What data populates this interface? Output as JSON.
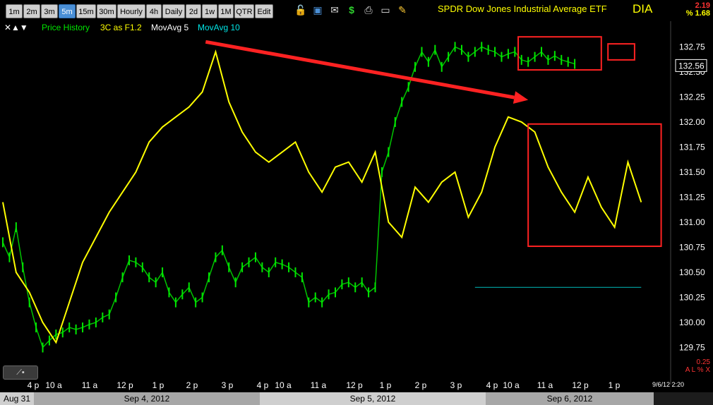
{
  "toolbar": {
    "intervals": [
      "1m",
      "2m",
      "3m",
      "5m",
      "15m",
      "30m",
      "Hourly",
      "4h",
      "Daily",
      "2d",
      "1w",
      "1M",
      "QTR",
      "Edit"
    ],
    "active_interval": "5m"
  },
  "header": {
    "title": "SPDR Dow Jones Industrial Average ETF",
    "symbol": "DIA",
    "change_abs": "2.19",
    "change_pct": "% 1.68"
  },
  "legend": {
    "price_history": "Price History",
    "indicator": "3C as F1.2",
    "ma5": "MovAvg 5",
    "ma10": "MovAvg 10",
    "controls": "✕▲▼"
  },
  "status": {
    "timestamp": "9/6/12 2:20",
    "bottom_value": "0.25",
    "bottom_marks": "A L % X"
  },
  "colors": {
    "price": "#00e600",
    "indicator": "#ffff00",
    "ma10": "#00bbbb",
    "annotation": "#ff2222",
    "axis_text": "#ffffff"
  },
  "chart_data": {
    "type": "line",
    "ylim": [
      129.5,
      132.95
    ],
    "yticks": [
      "132.75",
      "132.50",
      "132.25",
      "132.00",
      "131.75",
      "131.50",
      "131.25",
      "131.00",
      "130.75",
      "130.50",
      "130.25",
      "130.00",
      "129.75"
    ],
    "last_price": "132.56",
    "x_tick_labels": [
      "4 p",
      "10 a",
      "11 a",
      "12 p",
      "1 p",
      "2 p",
      "3 p",
      "4 p",
      "10 a",
      "11 a",
      "12 p",
      "1 p",
      "2 p",
      "3 p",
      "4 p",
      "10 a",
      "11 a",
      "12 p",
      "1 p"
    ],
    "date_labels": [
      "Aug 31",
      "Sep 4, 2012",
      "Sep 5, 2012",
      "Sep 6, 2012"
    ],
    "price_series": {
      "name": "Price History",
      "x": [
        0,
        2,
        4,
        6,
        8,
        10,
        12,
        14,
        16,
        18,
        20,
        22,
        24,
        26,
        28,
        30,
        32,
        34,
        36,
        38,
        40,
        42,
        44,
        46,
        48,
        50,
        52,
        54,
        56,
        58,
        60,
        62,
        64,
        66,
        68,
        70,
        72,
        74,
        76,
        78,
        80,
        82,
        84,
        86,
        88,
        90,
        92,
        94,
        96,
        98,
        100,
        102,
        104,
        106,
        108,
        110,
        112,
        114,
        116,
        118,
        120,
        122,
        124,
        126,
        128,
        130,
        132,
        134,
        136,
        138,
        140,
        142,
        144,
        146,
        148,
        150,
        152,
        154,
        156,
        158,
        160,
        162,
        164,
        166,
        168,
        170,
        172,
        174,
        176,
        178,
        180,
        182,
        184,
        186,
        188,
        190,
        192
      ],
      "y": [
        130.8,
        130.65,
        130.95,
        130.55,
        130.2,
        129.95,
        129.75,
        129.82,
        129.88,
        129.9,
        129.95,
        129.93,
        129.95,
        129.98,
        130.0,
        130.05,
        130.08,
        130.25,
        130.45,
        130.62,
        130.6,
        130.55,
        130.45,
        130.4,
        130.5,
        130.3,
        130.2,
        130.28,
        130.35,
        130.2,
        130.25,
        130.45,
        130.65,
        130.72,
        130.55,
        130.4,
        130.55,
        130.6,
        130.65,
        130.55,
        130.5,
        130.6,
        130.58,
        130.55,
        130.5,
        130.45,
        130.2,
        130.25,
        130.2,
        130.28,
        130.3,
        130.38,
        130.4,
        130.35,
        130.4,
        130.3,
        130.35,
        131.5,
        131.7,
        132.0,
        132.2,
        132.35,
        132.55,
        132.7,
        132.6,
        132.72,
        132.55,
        132.65,
        132.75,
        132.72,
        132.65,
        132.7,
        132.75,
        132.72,
        132.7,
        132.65,
        132.68,
        132.7,
        132.62,
        132.6,
        132.65,
        132.7,
        132.62,
        132.66,
        132.62,
        132.6,
        132.58
      ],
      "ma10_level": 130.35,
      "ma10_start_x": 142
    },
    "indicator_series": {
      "name": "3C as F1.2",
      "x": [
        0,
        4,
        8,
        12,
        16,
        20,
        24,
        28,
        32,
        36,
        40,
        44,
        48,
        52,
        56,
        60,
        64,
        68,
        72,
        76,
        80,
        84,
        88,
        92,
        96,
        100,
        104,
        108,
        112,
        116,
        120,
        124,
        128,
        132,
        136,
        140,
        144,
        148,
        152,
        156,
        160,
        164,
        168,
        172,
        176,
        180,
        184,
        188,
        192
      ],
      "y": [
        131.2,
        130.5,
        130.3,
        130.0,
        129.8,
        130.2,
        130.6,
        130.85,
        131.1,
        131.3,
        131.5,
        131.8,
        131.95,
        132.05,
        132.15,
        132.3,
        132.7,
        132.2,
        131.9,
        131.7,
        131.6,
        131.7,
        131.8,
        131.5,
        131.3,
        131.55,
        131.6,
        131.4,
        131.7,
        131.0,
        130.85,
        131.35,
        131.2,
        131.4,
        131.5,
        131.05,
        131.3,
        131.75,
        132.05,
        132.0,
        131.9,
        131.55,
        131.3,
        131.1,
        131.45,
        131.15,
        130.95,
        131.6,
        131.2
      ]
    },
    "annotations": [
      {
        "type": "arrow",
        "from": [
          61,
          132.8
        ],
        "to": [
          158,
          132.22
        ]
      },
      {
        "type": "box",
        "x": [
          155,
          180
        ],
        "y": [
          132.52,
          132.85
        ]
      },
      {
        "type": "box",
        "x": [
          182,
          190
        ],
        "y": [
          132.62,
          132.78
        ]
      },
      {
        "type": "box",
        "x": [
          158,
          198
        ],
        "y": [
          130.76,
          131.98
        ]
      }
    ]
  }
}
